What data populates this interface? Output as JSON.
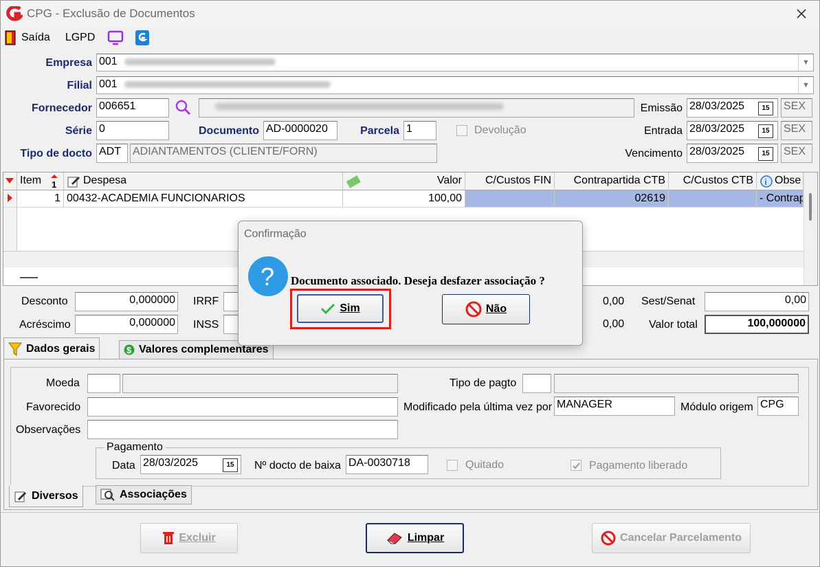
{
  "window": {
    "title": "CPG - Exclusão de Documentos"
  },
  "menu": {
    "exit": "Saída",
    "lgpd": "LGPD"
  },
  "header": {
    "empresa_label": "Empresa",
    "empresa_value": "001",
    "filial_label": "Filial",
    "filial_value": "001",
    "fornecedor_label": "Fornecedor",
    "fornecedor_value": "006651",
    "serie_label": "Série",
    "serie_value": "0",
    "documento_label": "Documento",
    "documento_value": "AD-0000020",
    "parcela_label": "Parcela",
    "parcela_value": "1",
    "devolucao_label": "Devolução",
    "tipo_label": "Tipo de docto",
    "tipo_code": "ADT",
    "tipo_desc": "ADIANTAMENTOS (CLIENTE/FORN)",
    "emissao_label": "Emissão",
    "emissao_value": "28/03/2025",
    "emissao_day": "SEX",
    "entrada_label": "Entrada",
    "entrada_value": "28/03/2025",
    "entrada_day": "SEX",
    "vencimento_label": "Vencimento",
    "vencimento_value": "28/03/2025",
    "vencimento_day": "SEX",
    "cal_icon": "15"
  },
  "grid": {
    "columns": [
      "Item",
      "Despesa",
      "Valor",
      "C/Custos FIN",
      "Contrapartida CTB",
      "C/Custos CTB",
      "Obse"
    ],
    "rows": [
      {
        "item": "1",
        "despesa": "00432-ACADEMIA FUNCIONARIOS",
        "valor": "100,00",
        "cc_fin": "",
        "contrapartida": "02619",
        "cc_ctb": "",
        "obs": "- Contrap"
      }
    ]
  },
  "totals": {
    "desconto_label": "Desconto",
    "desconto_value": "0,000000",
    "acrescimo_label": "Acréscimo",
    "acrescimo_value": "0,000000",
    "irrf_label": "IRRF",
    "inss_label": "INSS",
    "mid1_value": "0,00",
    "mid2_value": "0,00",
    "sest_label": "Sest/Senat",
    "sest_value": "0,00",
    "total_label": "Valor total",
    "total_value": "100,000000"
  },
  "tabs": {
    "dados_gerais": "Dados gerais",
    "valores_complementares": "Valores complementares",
    "diversos": "Diversos",
    "associacoes": "Associações"
  },
  "details": {
    "moeda_label": "Moeda",
    "favorecido_label": "Favorecido",
    "observacoes_label": "Observações",
    "tipo_pagto_label": "Tipo de pagto",
    "modificado_label": "Modificado pela última vez por",
    "modificado_value": "MANAGER",
    "modulo_label": "Módulo origem",
    "modulo_value": "CPG",
    "pagamento_group": "Pagamento",
    "data_label": "Data",
    "data_value": "28/03/2025",
    "ndocto_label": "Nº docto de baixa",
    "ndocto_value": "DA-0030718",
    "quitado_label": "Quitado",
    "pag_liberado_label": "Pagamento liberado"
  },
  "footer": {
    "excluir": "Excluir",
    "limpar": "Limpar",
    "cancelar": "Cancelar Parcelamento"
  },
  "dialog": {
    "title": "Confirmação",
    "message": "Documento associado. Deseja desfazer associação ?",
    "yes": "Sim",
    "no": "Não"
  },
  "colors": {
    "label_blue": "#1c2a6b",
    "highlight_red": "#e0201a",
    "selected_cell": "#a6b8e6",
    "accent": "#7b2fbf"
  },
  "icons": [
    "app-logo-icon",
    "exit-door-icon",
    "monitor-icon",
    "g-logo-icon",
    "search-icon",
    "calendar-icon",
    "filter-icon",
    "dollar-icon",
    "pencil-icon",
    "magnifier-doc-icon",
    "trash-icon",
    "eraser-icon",
    "cancel-icon",
    "question-icon",
    "check-icon",
    "no-entry-icon",
    "close-icon"
  ]
}
